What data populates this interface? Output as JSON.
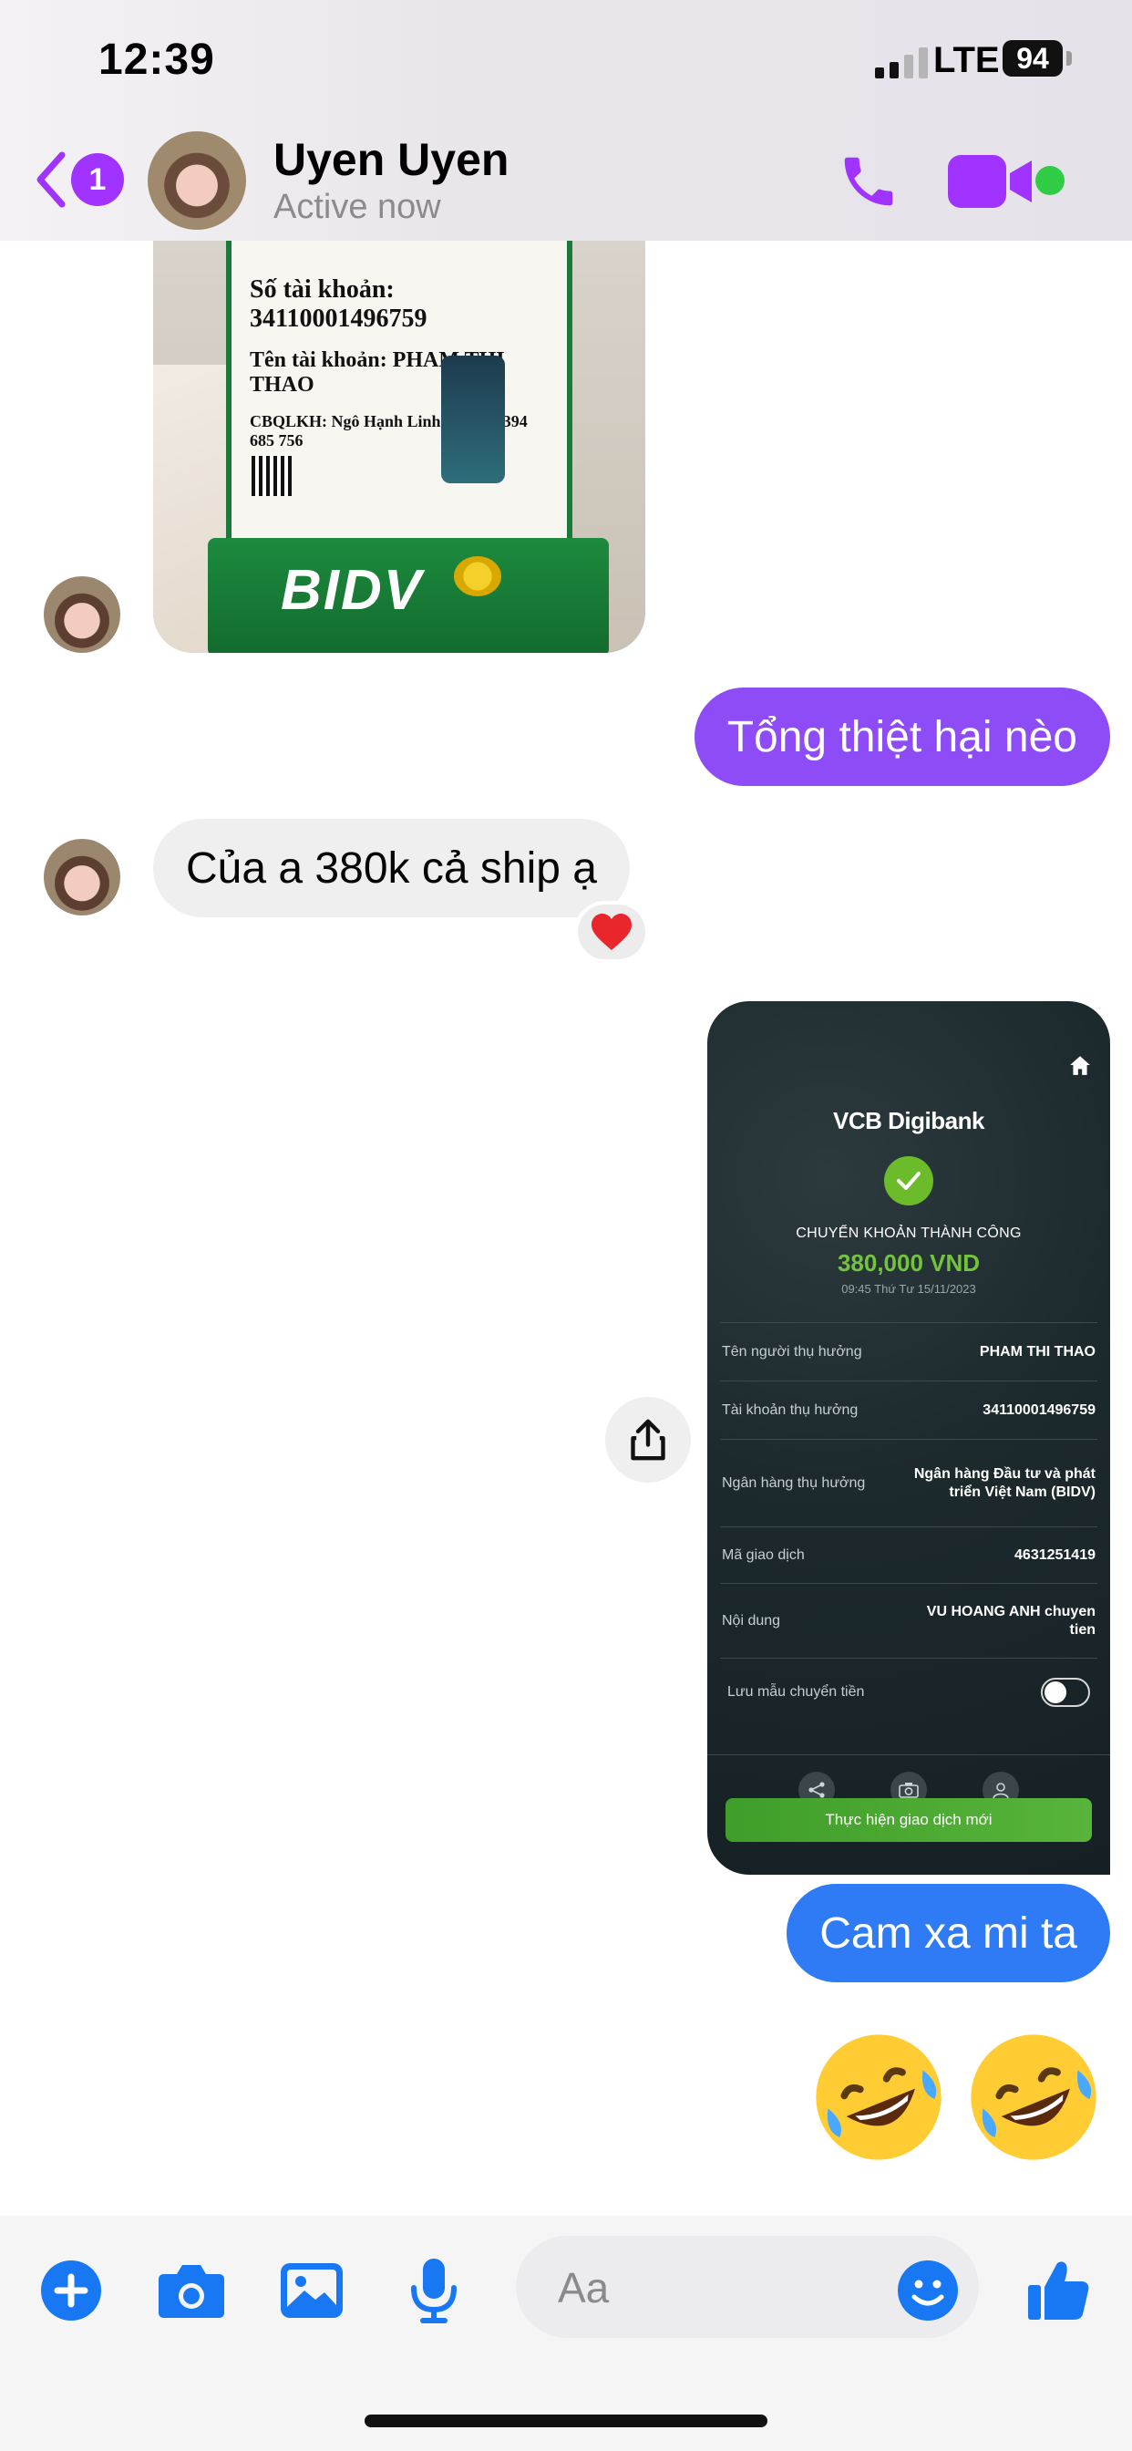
{
  "status_bar": {
    "time": "12:39",
    "network": "LTE",
    "battery": "94"
  },
  "header": {
    "back_count": "1",
    "name": "Uyen Uyen",
    "status": "Active now"
  },
  "colors": {
    "accent": "#8d4cf6",
    "blue_bubble": "#2f7bf5",
    "online": "#31cc46",
    "reaction": "#e8262c"
  },
  "photo": {
    "account_number": "Số tài khoản: 34110001496759",
    "account_name": "Tên tài khoản: PHAM THI THAO",
    "branch": "CBQLKH: Ngô Hạnh Linh - SĐT: 0394 685 756",
    "bank_logo": "BIDV"
  },
  "messages": {
    "out_1": "Tổng thiệt hại nèo",
    "in_1": "Của a 380k cả ship ạ",
    "in_1_reaction": "heart",
    "out_2": "Cam xa mi ta",
    "out_3_emoji": [
      "rolling-on-floor-laughing",
      "rolling-on-floor-laughing"
    ]
  },
  "receipt": {
    "brand": "VCB Digibank",
    "title": "CHUYỂN KHOẢN THÀNH CÔNG",
    "amount": "380,000 VND",
    "time": "09:45 Thứ Tư 15/11/2023",
    "rows": [
      {
        "k": "Tên người thụ hưởng",
        "v": "PHAM THI THAO"
      },
      {
        "k": "Tài khoản thụ hưởng",
        "v": "34110001496759"
      },
      {
        "k": "Ngân hàng thụ hưởng",
        "v": "Ngân hàng  Đầu tư và phát triển Việt Nam (BIDV)"
      },
      {
        "k": "Mã giao dịch",
        "v": "4631251419"
      },
      {
        "k": "Nội dung",
        "v": "VU HOANG ANH chuyen tien"
      }
    ],
    "save_template_label": "Lưu mẫu chuyển tiền",
    "action_button": "Thực hiện giao dịch mới"
  },
  "composer": {
    "placeholder": "Aa"
  }
}
